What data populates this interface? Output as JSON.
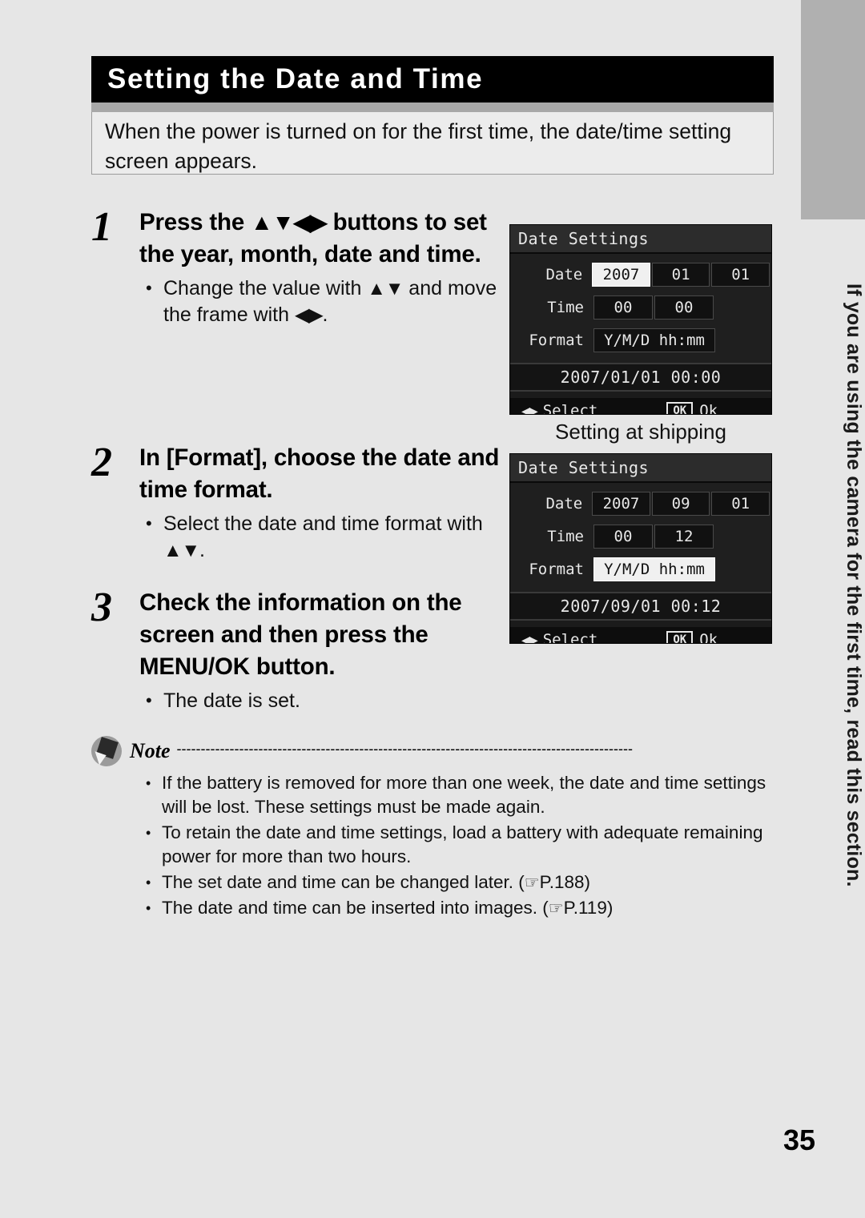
{
  "page": {
    "number": "35",
    "side_tab_text": "If you are using the camera for the first time, read this section."
  },
  "header": {
    "title": "Setting the Date and Time",
    "intro": "When the power is turned on for the first time, the date/time setting screen appears."
  },
  "steps": [
    {
      "number": "1",
      "heading_pre": "Press the ",
      "heading_arrows": "▲▼◀▶",
      "heading_post": " buttons to set the year, month, date and time.",
      "bullets": [
        {
          "pre": "Change the value with ",
          "arrows": "▲▼",
          "mid": " and move the frame with ",
          "arrows2": "◀▶",
          "post": "."
        }
      ]
    },
    {
      "number": "2",
      "heading_pre": "In [Format], choose the date and time format.",
      "heading_arrows": "",
      "heading_post": "",
      "bullets": [
        {
          "pre": "Select the date and time format with ",
          "arrows": "▲▼",
          "mid": "",
          "arrows2": "",
          "post": "."
        }
      ]
    },
    {
      "number": "3",
      "heading_pre": "Check the information on the screen and then press the MENU/OK button.",
      "heading_arrows": "",
      "heading_post": "",
      "bullets": [
        {
          "pre": "The date is set.",
          "arrows": "",
          "mid": "",
          "arrows2": "",
          "post": ""
        }
      ]
    }
  ],
  "screens": [
    {
      "title": "Date Settings",
      "row_date_label": "Date",
      "row_time_label": "Time",
      "row_format_label": "Format",
      "date_year": "2007",
      "date_month": "01",
      "date_day": "01",
      "time_hour": "00",
      "time_minute": "00",
      "format_value": "Y/M/D hh:mm",
      "preview": "2007/01/01 00:00",
      "foot_arrows": "◀▶",
      "foot_select": "Select",
      "foot_ok_chip": "OK",
      "foot_ok_label": "Ok",
      "selected_field": "year"
    },
    {
      "title": "Date Settings",
      "row_date_label": "Date",
      "row_time_label": "Time",
      "row_format_label": "Format",
      "date_year": "2007",
      "date_month": "09",
      "date_day": "01",
      "time_hour": "00",
      "time_minute": "12",
      "format_value": "Y/M/D hh:mm",
      "preview": "2007/09/01 00:12",
      "foot_arrows": "◀▶",
      "foot_select": "Select",
      "foot_ok_chip": "OK",
      "foot_ok_label": "Ok",
      "selected_field": "format"
    }
  ],
  "caption": {
    "setting_at_shipping": "Setting at shipping"
  },
  "note": {
    "label": "Note",
    "dashes": "-----------------------------------------------------------------------------------------------",
    "items": [
      {
        "text": "If the battery is removed for more than one week, the date and time settings will be lost. These settings must be made again.",
        "ref": ""
      },
      {
        "text": "To retain the date and time settings, load a battery with adequate remaining power for more than two hours.",
        "ref": ""
      },
      {
        "text": "The set date and time can be changed later. (",
        "ref": "P.188",
        "tail": ")"
      },
      {
        "text": "The date and time can be inserted into images. (",
        "ref": "P.119",
        "tail": ")"
      }
    ]
  },
  "colors": {
    "page_bg": "#e6e6e6",
    "title_bar": "#000000",
    "sub_bar": "#a8a8a8",
    "side_tab": "#b0b0b0",
    "lcd_bg": "#1b1b1b",
    "lcd_selected": "#f0f0f0"
  }
}
